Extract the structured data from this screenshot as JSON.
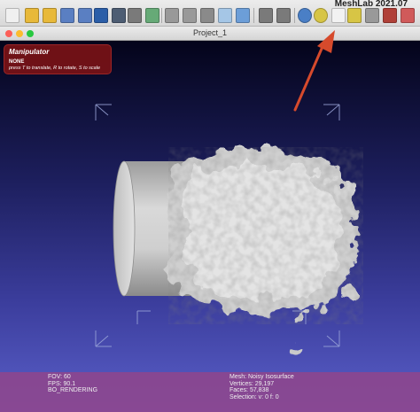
{
  "app": {
    "title": "MeshLab 2021.07"
  },
  "toolbar": {
    "buttons": [
      {
        "name": "new-project-icon",
        "color": "#f0f0f0"
      },
      {
        "name": "open-project-icon",
        "color": "#e8b93a"
      },
      {
        "name": "open-mesh-icon",
        "color": "#e8b93a"
      },
      {
        "name": "reload-icon",
        "color": "#5a7fc2"
      },
      {
        "name": "reload-all-icon",
        "color": "#5a7fc2"
      },
      {
        "name": "save-icon",
        "color": "#2b5ea8"
      },
      {
        "name": "snapshot-icon",
        "color": "#4d5d73"
      },
      {
        "name": "layers-icon",
        "color": "#7a7a7a"
      },
      {
        "name": "rendering-icon",
        "color": "#66aa77"
      },
      {
        "name": "bbox-icon",
        "color": "#999999"
      },
      {
        "name": "points-icon",
        "color": "#999999"
      },
      {
        "name": "wireframe-icon",
        "color": "#8a8a8a"
      },
      {
        "name": "flat-icon",
        "color": "#a5c6e6"
      },
      {
        "name": "smooth-icon",
        "color": "#6c9ed8"
      },
      {
        "name": "lighting-icon",
        "color": "#7a7a7a"
      },
      {
        "name": "manipulator-icon",
        "color": "#7a7a7a"
      },
      {
        "name": "sphere-icon",
        "color": "#4a7fc6"
      },
      {
        "name": "annotation-icon",
        "color": "#d7c545"
      },
      {
        "name": "measure-icon",
        "color": "#f2f2f2"
      },
      {
        "name": "pick-icon",
        "color": "#d7c545"
      },
      {
        "name": "paint-icon",
        "color": "#999999"
      },
      {
        "name": "brush-icon",
        "color": "#b04038"
      },
      {
        "name": "texture-icon",
        "color": "#d05a5a"
      }
    ]
  },
  "document": {
    "title": "Project_1"
  },
  "manipulator": {
    "title": "Manipulator",
    "mode": "NONE",
    "hint": "press T to translate, R to rotate, S to scale"
  },
  "info": {
    "fov": "FOV: 60",
    "fps": "FPS:     90.1",
    "rendering": "BO_RENDERING",
    "mesh": "Mesh: Noisy Isosurface",
    "vertices": "Vertices: 29,197",
    "faces": "Faces: 57,838",
    "selection": "Selection: v: 0 f: 0"
  },
  "colors": {
    "traffic_close": "#fc5f57",
    "traffic_min": "#fcbc2e",
    "traffic_max": "#28c840",
    "arrow": "#d64a2c"
  }
}
